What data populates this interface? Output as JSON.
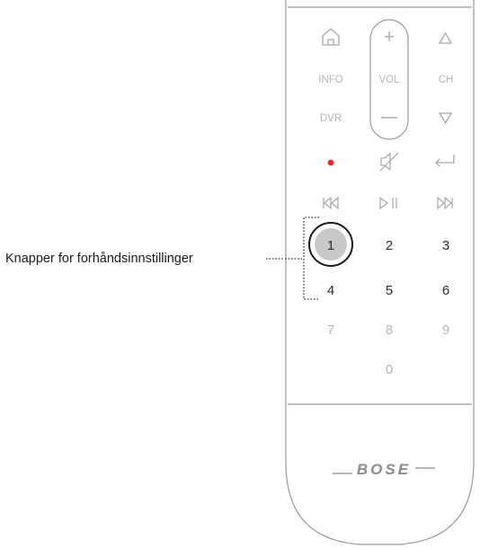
{
  "callout": {
    "label": "Knapper for forhåndsinnstillinger"
  },
  "remote": {
    "row1": {
      "home": "home-icon",
      "plus": "+",
      "up": "up-triangle-icon"
    },
    "row2": {
      "info": "INFO",
      "vol": "VOL",
      "ch": "CH"
    },
    "row3": {
      "dvr": "DVR",
      "minus": "–",
      "down": "down-triangle-icon"
    },
    "row4": {
      "record": "record-icon",
      "mute": "mute-icon",
      "back": "return-icon"
    },
    "row5": {
      "prev": "skip-back-icon",
      "playpause": "play-pause-icon",
      "next": "skip-forward-icon"
    },
    "keypad": {
      "k1": "1",
      "k2": "2",
      "k3": "3",
      "k4": "4",
      "k5": "5",
      "k6": "6",
      "k7": "7",
      "k8": "8",
      "k9": "9",
      "k0": "0"
    },
    "brand": "BOSE"
  },
  "colors": {
    "record_red": "#e8262b",
    "dim_text": "#b4b4b4",
    "preset_text": "#2b2b2b",
    "highlight_fill": "#c8c8c8"
  }
}
